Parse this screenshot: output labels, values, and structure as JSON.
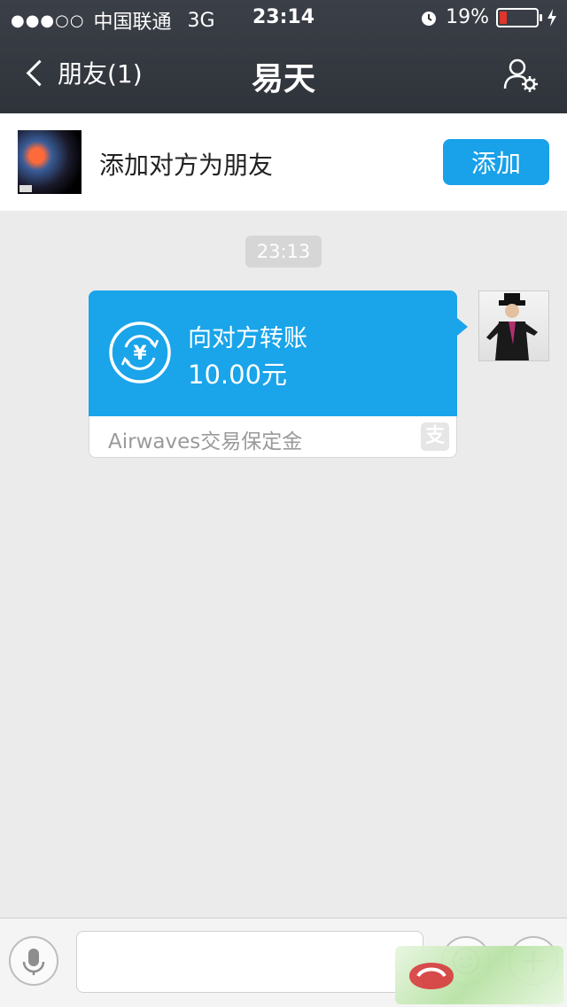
{
  "status_bar": {
    "signal": "●●●○○",
    "carrier": "中国联通",
    "network": "3G",
    "time": "23:14",
    "battery": "19%",
    "battery_level": 0.19
  },
  "nav": {
    "back_label": "朋友(1)",
    "title": "易天"
  },
  "add_bar": {
    "prompt": "添加对方为朋友",
    "button_label": "添加"
  },
  "chat": {
    "timestamp": "23:13",
    "transfer": {
      "label": "向对方转账",
      "amount": "10.00元",
      "note": "Airwaves交易保定金",
      "source_icon": "支"
    }
  },
  "input_bar": {
    "text_value": ""
  },
  "colors": {
    "accent": "#19a1ea",
    "header_bg": "#373b42",
    "chat_bg": "#ebebeb"
  },
  "icons": [
    "chevron-left-icon",
    "profile-settings-icon",
    "yuan-transfer-icon",
    "alipay-icon",
    "microphone-icon",
    "emoji-icon",
    "plus-icon",
    "alarm-icon",
    "battery-icon",
    "charging-icon"
  ]
}
